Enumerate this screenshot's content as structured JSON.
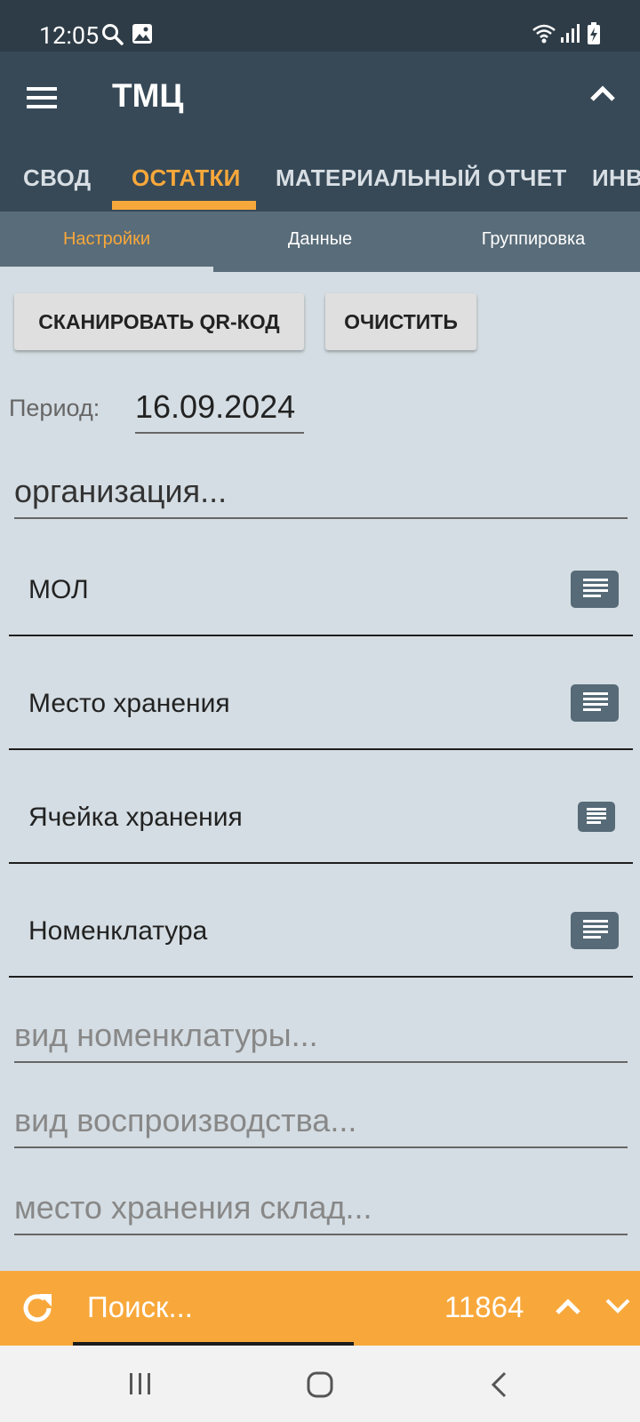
{
  "status_bar": {
    "time": "12:05",
    "icons": [
      "search-icon",
      "image-icon",
      "wifi-icon",
      "signal-icon",
      "battery-charging-icon"
    ]
  },
  "app_bar": {
    "title": "ТМЦ",
    "menu_icon": "hamburger-menu-icon",
    "collapse_icon": "chevron-up-icon"
  },
  "tabs": [
    {
      "label": "СВОД",
      "active": false
    },
    {
      "label": "ОСТАТКИ",
      "active": true
    },
    {
      "label": "МАТЕРИАЛЬНЫЙ ОТЧЕТ",
      "active": false
    },
    {
      "label": "ИНВ",
      "active": false
    }
  ],
  "subtabs": [
    {
      "label": "Настройки",
      "active": true
    },
    {
      "label": "Данные",
      "active": false
    },
    {
      "label": "Группировка",
      "active": false
    }
  ],
  "actions": {
    "scan_label": "СКАНИРОВАТЬ QR-КОД",
    "clear_label": "ОЧИСТИТЬ"
  },
  "period": {
    "label": "Период:",
    "value": "16.09.2024"
  },
  "fields": {
    "organization_placeholder": "организация...",
    "nomenclature_type_placeholder": "вид номенклатуры...",
    "reproduction_type_placeholder": "вид воспроизводства...",
    "warehouse_location_placeholder": "место хранения склад..."
  },
  "selectors": [
    {
      "label": "МОЛ",
      "icon": "list-icon"
    },
    {
      "label": "Место хранения",
      "icon": "list-icon"
    },
    {
      "label": "Ячейка хранения",
      "icon": "list-icon"
    },
    {
      "label": "Номенклатура",
      "icon": "list-icon"
    }
  ],
  "bottom_bar": {
    "refresh_icon": "refresh-icon",
    "search_placeholder": "Поиск...",
    "count": "11864",
    "prev_icon": "chevron-up-icon",
    "next_icon": "chevron-down-icon"
  },
  "system_nav": {
    "icons": [
      "recent-apps-icon",
      "home-icon",
      "back-icon"
    ]
  },
  "colors": {
    "accent": "#f8a83b",
    "app_bar": "#374957",
    "status_bar": "#2e3c47",
    "subtab_bar": "#596c79",
    "background": "#d4dde3",
    "list_button": "#566a77"
  }
}
